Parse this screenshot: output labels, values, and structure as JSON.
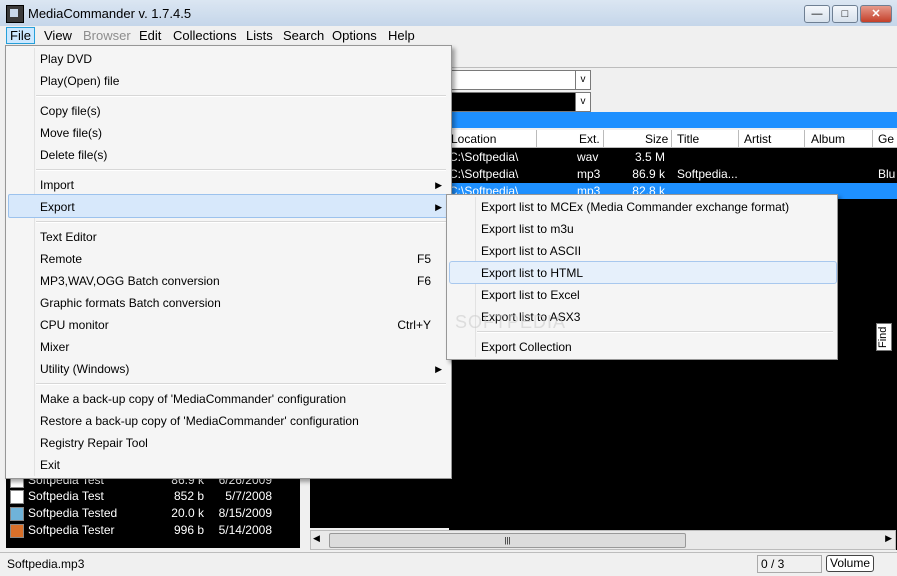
{
  "window": {
    "title": "MediaCommander v. 1.7.4.5",
    "controls": {
      "minimize": "—",
      "maximize": "□",
      "close": "✕"
    }
  },
  "menubar": {
    "items": [
      "File",
      "View",
      "Browser",
      "Edit",
      "Collections",
      "Lists",
      "Search",
      "Options",
      "Help"
    ]
  },
  "file_menu": {
    "play_dvd": "Play DVD",
    "play_open": "Play(Open) file",
    "copy": "Copy file(s)",
    "move": "Move file(s)",
    "delete": "Delete file(s)",
    "import": "Import",
    "export": "Export",
    "text_editor": "Text Editor",
    "remote": "Remote",
    "remote_shortcut": "F5",
    "batch_audio": "MP3,WAV,OGG  Batch conversion",
    "batch_audio_shortcut": "F6",
    "batch_graphic": "Graphic formats  Batch conversion",
    "cpu_monitor": "CPU monitor",
    "cpu_monitor_shortcut": "Ctrl+Y",
    "mixer": "Mixer",
    "utility": "Utility (Windows)",
    "backup": "Make a back-up copy of 'MediaCommander' configuration",
    "restore": "Restore a back-up copy of 'MediaCommander' configuration",
    "registry": "Registry Repair Tool",
    "exit": "Exit"
  },
  "export_submenu": {
    "mcex": "Export list to MCEx (Media Commander exchange format)",
    "m3u": "Export list to m3u",
    "ascii": "Export list to ASCII",
    "html": "Export list to HTML",
    "excel": "Export list to Excel",
    "asx3": "Export list to ASX3",
    "collection": "Export Collection"
  },
  "list_view": {
    "columns": [
      "Location",
      "Ext.",
      "Size",
      "Title",
      "Artist",
      "Album",
      "Ge"
    ],
    "rows": [
      {
        "location": "C:\\Softpedia\\",
        "ext": "wav",
        "size": "3.5 M",
        "title": "",
        "genre": ""
      },
      {
        "location": "C:\\Softpedia\\",
        "ext": "mp3",
        "size": "86.9 k",
        "title": "Softpedia...",
        "genre": "Blu"
      },
      {
        "location": "C:\\Softpedia\\",
        "ext": "mp3",
        "size": "82.8 k",
        "title": "",
        "genre": ""
      }
    ]
  },
  "left_panel": {
    "rows": [
      {
        "name": "Softpedia Test",
        "size": "86.9 k",
        "date": "6/26/2009"
      },
      {
        "name": "Softpedia Test",
        "size": "852 b",
        "date": "5/7/2008"
      },
      {
        "name": "Softpedia Tested",
        "size": "20.0 k",
        "date": "8/15/2009"
      },
      {
        "name": "Softpedia Tester",
        "size": "996 b",
        "date": "5/14/2008"
      }
    ]
  },
  "combos": {
    "arrow": "v"
  },
  "find_tab": "Find",
  "watermark": "SOFTPEDIA",
  "statusbar": {
    "file": "Softpedia.mp3",
    "count": "0 / 3",
    "volume": "Volume"
  }
}
